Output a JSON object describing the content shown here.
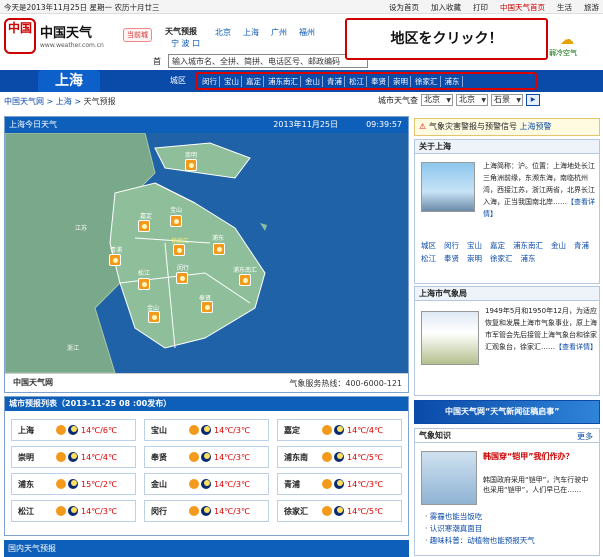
{
  "topbar": {
    "date": "今天是2013年11月25日 星期一 农历十月廿三",
    "links": [
      "设为首页",
      "加入收藏",
      "打印",
      "中国天气首页",
      "生活",
      "旅游"
    ]
  },
  "logo": {
    "seal": "中国",
    "name": "中国天气",
    "url": "www.weather.com.cn"
  },
  "badge": "当前城",
  "city_header": {
    "label": "天气预报",
    "sub": "宁 波 口"
  },
  "city_tabs": [
    "北京",
    "上海",
    "广州",
    "福州"
  ],
  "search": {
    "label": "首",
    "placeholder": "输入城市名、全拼、简拼、电话区号、邮政编码"
  },
  "weather_widget": {
    "label": "弱冷空气"
  },
  "callout": "地区をクリック！",
  "nav": {
    "city": "上海",
    "area_label": "城区",
    "districts": [
      "闵行",
      "宝山",
      "嘉定",
      "浦东南汇",
      "金山",
      "青浦",
      "松江",
      "奉贤",
      "崇明",
      "徐家汇",
      "浦东"
    ]
  },
  "breadcrumb": {
    "home": "中国天气网",
    "sep1": " > ",
    "city": "上海",
    "sep2": " > ",
    "current": "天气预报"
  },
  "city_select": {
    "label": "城市天气查",
    "province": "北京",
    "city": "北京",
    "district": "石景",
    "go": "▶"
  },
  "map": {
    "title": "上海今日天气",
    "date": "2013年11月25日",
    "time": "09:39:57",
    "labels": {
      "jiangsu": "江苏",
      "zhejiang": "浙江"
    },
    "districts": [
      {
        "name": "崇明"
      },
      {
        "name": "嘉定"
      },
      {
        "name": "宝山"
      },
      {
        "name": "青浦"
      },
      {
        "name": "徐家汇"
      },
      {
        "name": "浦东"
      },
      {
        "name": "松江"
      },
      {
        "name": "闵行"
      },
      {
        "name": "浦东南汇"
      },
      {
        "name": "金山"
      },
      {
        "name": "奉贤"
      }
    ],
    "footer_logo": "中国天气网",
    "hotline": "气象服务热线：400-6000-121"
  },
  "forecast": {
    "title": "城市预报列表（2013-11-25 08 :00发布）",
    "rows": [
      {
        "name": "上海",
        "temp": "14℃/6℃"
      },
      {
        "name": "宝山",
        "temp": "14℃/3℃"
      },
      {
        "name": "嘉定",
        "temp": "14℃/4℃"
      },
      {
        "name": "崇明",
        "temp": "14℃/4℃"
      },
      {
        "name": "奉贤",
        "temp": "14℃/3℃"
      },
      {
        "name": "浦东南",
        "temp": "14℃/5℃"
      },
      {
        "name": "浦东",
        "temp": "15℃/2℃"
      },
      {
        "name": "金山",
        "temp": "14℃/3℃"
      },
      {
        "name": "青浦",
        "temp": "14℃/3℃"
      },
      {
        "name": "松江",
        "temp": "14℃/3℃"
      },
      {
        "name": "闵行",
        "temp": "14℃/3℃"
      },
      {
        "name": "徐家汇",
        "temp": "14℃/5℃"
      }
    ]
  },
  "bottom_header": "国内天气预报",
  "alert": {
    "text": "气象灾害警报与预警信号",
    "link": "上海预警"
  },
  "about": {
    "title": "关于上海",
    "text": "上海简称：沪。位置：上海地处长江三角洲前缘，东濒东海，南临杭州湾，西接江苏，浙江两省，北界长江入海，正当我国南北岸……",
    "more": "【查看详情】",
    "districts": [
      "城区",
      "闵行",
      "宝山",
      "嘉定",
      "浦东南汇",
      "金山",
      "青浦",
      "松江",
      "奉贤",
      "崇明",
      "徐家汇",
      "浦东"
    ]
  },
  "history": {
    "title": "上海市气象局",
    "text": "1949年5月和1950年12月，为适应恢复和发展上海市气象事业，原上海市军管会先后接管上海气象台和徐家汇观象台，徐家汇……",
    "more": "【查看详情】"
  },
  "banner": "中国天气网“天气新闻征稿启事”",
  "knowledge": {
    "title": "气象知识",
    "more": "更多",
    "headline": "韩国穿“铠甲”我们作办？",
    "text": "韩国政府采用“铠甲”，汽车行驶中也采用“铠甲”，人们早已在……",
    "items": [
      "雾霾也能当饭吃",
      "认识寒潮真面目",
      "趣味科普：动植物也能预报天气"
    ]
  }
}
